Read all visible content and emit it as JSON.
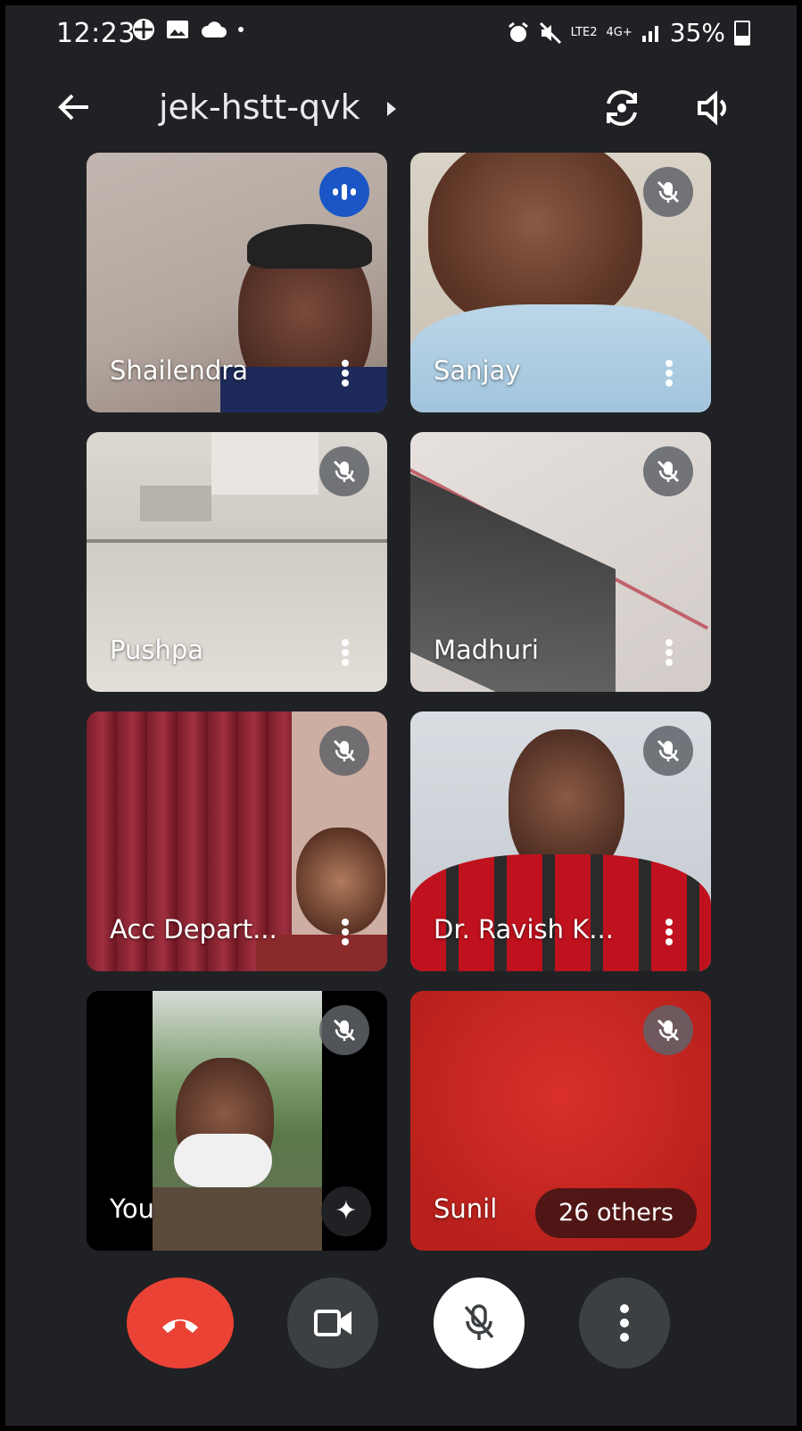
{
  "status": {
    "time": "12:23",
    "network": "LTE2",
    "signal": "4G+",
    "battery": "35%"
  },
  "header": {
    "meeting_code": "jek-hstt-qvk"
  },
  "participants": [
    {
      "name": "Shailendra",
      "state": "speaking"
    },
    {
      "name": "Sanjay",
      "state": "muted"
    },
    {
      "name": "Pushpa",
      "state": "muted"
    },
    {
      "name": "Madhuri",
      "state": "muted"
    },
    {
      "name": "Acc Depart...",
      "state": "muted"
    },
    {
      "name": "Dr. Ravish K...",
      "state": "muted"
    },
    {
      "name": "You",
      "state": "muted"
    },
    {
      "name": "Sunil",
      "state": "muted"
    }
  ],
  "overflow": {
    "label": "26 others"
  },
  "colors": {
    "background": "#202124",
    "end_call": "#ea4335",
    "speaking": "#1a56c5",
    "sunil_tile": "#c5221f"
  }
}
